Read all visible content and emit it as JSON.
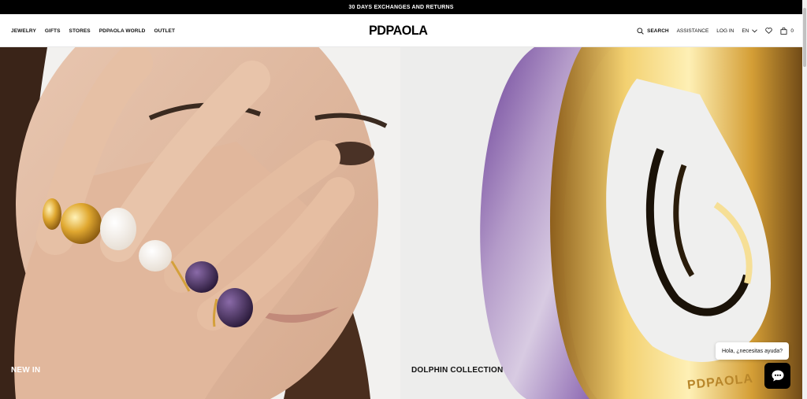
{
  "promo": {
    "text": "30 DAYS EXCHANGES AND RETURNS"
  },
  "header": {
    "logo": "PDPAOLA",
    "nav_left": [
      {
        "label": "JEWELRY"
      },
      {
        "label": "GIFTS"
      },
      {
        "label": "STORES"
      },
      {
        "label": "PDPAOLA WORLD"
      },
      {
        "label": "OUTLET"
      }
    ],
    "search_label": "SEARCH",
    "assistance_label": "ASSISTANCE",
    "login_label": "LOG IN",
    "language": "EN",
    "cart_count": "0",
    "icons": [
      "search-icon",
      "chevron-down-icon",
      "heart-icon",
      "bag-icon"
    ]
  },
  "hero": {
    "left_title": "NEW IN",
    "right_title": "DOLPHIN COLLECTION",
    "right_engraving": "PDPAOLA"
  },
  "chat": {
    "prompt": "Hola, ¿necesitas ayuda?",
    "icon": "chat-icon"
  },
  "colors": {
    "promo_bg": "#000000",
    "accent_purple": "#7a5a9e",
    "gold": "#d6a23a"
  }
}
